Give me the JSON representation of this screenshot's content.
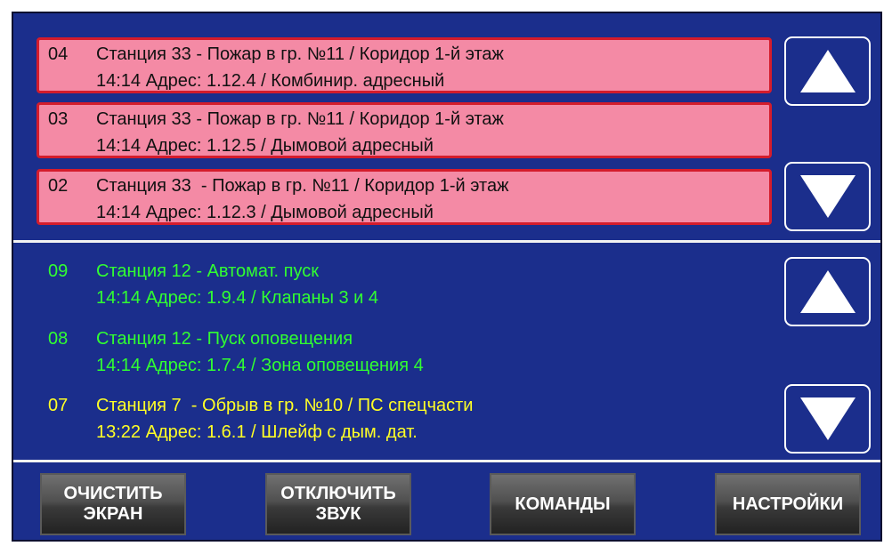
{
  "colors": {
    "panel_bg": "#1b2e8c",
    "alarm_bg": "#f48aa5",
    "alarm_border": "#d41c2c",
    "event_green": "#31ff31",
    "event_yellow": "#ffff26"
  },
  "alarms": [
    {
      "num": "04",
      "line1": "Станция 33 - Пожар в гр. №11 / Коридор 1-й этаж",
      "line2": "14:14 Адрес: 1.12.4 / Комбинир. адресный"
    },
    {
      "num": "03",
      "line1": "Станция 33 - Пожар в гр. №11 / Коридор 1-й этаж",
      "line2": "14:14 Адрес: 1.12.5 / Дымовой адресный"
    },
    {
      "num": "02",
      "line1": "Станция 33  - Пожар в гр. №11 / Коридор 1-й этаж",
      "line2": "14:14 Адрес: 1.12.3 / Дымовой адресный"
    }
  ],
  "events": [
    {
      "num": "09",
      "line1": "Станция 12 - Автомат. пуск",
      "line2": "14:14 Адрес: 1.9.4 / Клапаны 3 и 4",
      "color": "green"
    },
    {
      "num": "08",
      "line1": "Станция 12 - Пуск оповещения",
      "line2": "14:14 Адрес: 1.7.4 / Зона оповещения 4",
      "color": "green"
    },
    {
      "num": "07",
      "line1": "Станция 7  - Обрыв в гр. №10 / ПС спецчасти",
      "line2": "13:22 Адрес: 1.6.1 / Шлейф с дым. дат.",
      "color": "yellow"
    }
  ],
  "icons": {
    "up": "triangle-up-icon",
    "down": "triangle-down-icon"
  },
  "buttons": {
    "clear_screen": "ОЧИСТИТЬ\nЭКРАН",
    "mute_sound": "ОТКЛЮЧИТЬ\nЗВУК",
    "commands": "КОМАНДЫ",
    "settings": "НАСТРОЙКИ"
  }
}
